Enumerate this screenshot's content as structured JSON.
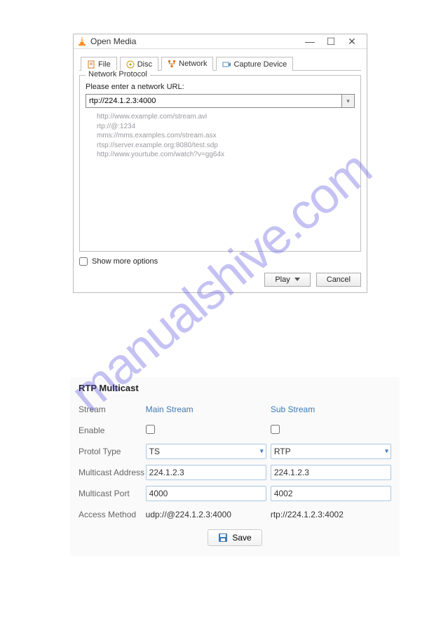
{
  "vlc": {
    "title": "Open Media",
    "tabs": {
      "file": "File",
      "disc": "Disc",
      "network": "Network",
      "capture": "Capture Device"
    },
    "group_legend": "Network Protocol",
    "url_label": "Please enter a network URL:",
    "url_value": "rtp://224.1.2.3:4000",
    "hints": [
      "http://www.example.com/stream.avi",
      "rtp://@:1234",
      "mms://mms.examples.com/stream.asx",
      "rtsp://server.example.org:8080/test.sdp",
      "http://www.yourtube.com/watch?v=gg64x"
    ],
    "show_more": "Show more options",
    "play": "Play",
    "cancel": "Cancel"
  },
  "rtp": {
    "title": "RTP Multicast",
    "rows": {
      "stream": "Stream",
      "enable": "Enable",
      "protocol": "Protol Type",
      "address": "Multicast Address",
      "port": "Multicast Port",
      "access": "Access Method"
    },
    "main": {
      "header": "Main Stream",
      "protocol": "TS",
      "address": "224.1.2.3",
      "port": "4000",
      "access": "udp://@224.1.2.3:4000"
    },
    "sub": {
      "header": "Sub Stream",
      "protocol": "RTP",
      "address": "224.1.2.3",
      "port": "4002",
      "access": "rtp://224.1.2.3:4002"
    },
    "save": "Save"
  },
  "watermark": "manualshive.com"
}
